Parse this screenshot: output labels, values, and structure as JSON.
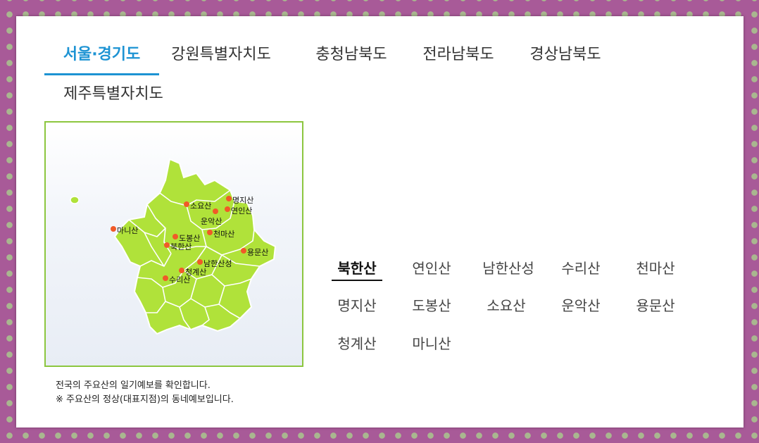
{
  "tabs": [
    {
      "label": "서울·경기도",
      "active": true
    },
    {
      "label": "강원특별자치도",
      "active": false
    },
    {
      "label": "충청남북도",
      "active": false
    },
    {
      "label": "전라남북도",
      "active": false
    },
    {
      "label": "경상남북도",
      "active": false
    },
    {
      "label": "제주특별자치도",
      "active": false
    }
  ],
  "map": {
    "mountains": [
      "명지산",
      "소요산",
      "연인산",
      "운악산",
      "천마산",
      "마니산",
      "도봉산",
      "북한산",
      "용문산",
      "남한산성",
      "청계산",
      "수리산"
    ]
  },
  "notes": {
    "line1": "전국의 주요산의 일기예보를 확인합니다.",
    "line2": "※ 주요산의 정상(대표지점)의 동네예보입니다."
  },
  "mountain_list": {
    "selected": "북한산",
    "items": [
      "북한산",
      "연인산",
      "남한산성",
      "수리산",
      "천마산",
      "명지산",
      "도봉산",
      "소요산",
      "운악산",
      "용문산",
      "청계산",
      "마니산"
    ]
  },
  "colors": {
    "accent": "#1d93d3",
    "map_fill": "#b0e23a",
    "map_border": "#8cc63f",
    "marker": "#f05a28",
    "frame": "#a85a98"
  }
}
